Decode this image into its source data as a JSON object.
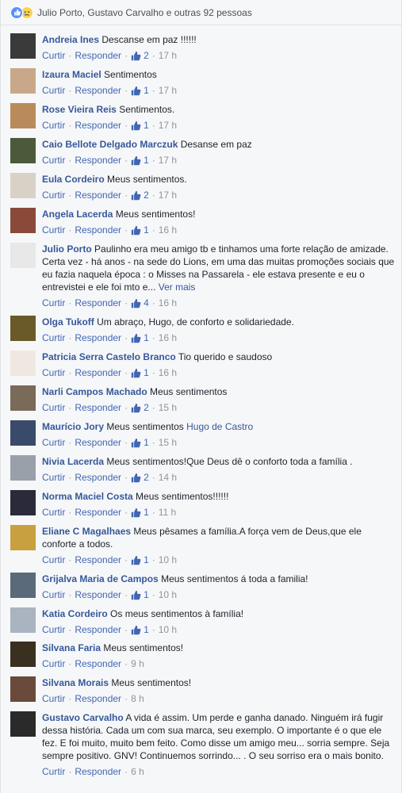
{
  "reactions": {
    "summary": "Julio Porto, Gustavo Carvalho e outras 92 pessoas",
    "like_icon": "like-icon",
    "sad_icon": "sad-icon"
  },
  "actions": {
    "reply": "Responder",
    "like": "Curtir"
  },
  "comments": [
    {
      "name": "Andreia Ines",
      "text": "Descanse em paz !!!!!!",
      "likes": "2",
      "time": "17 h",
      "avatar_color": "#3a3a3a"
    },
    {
      "name": "Izaura Maciel",
      "text": "Sentimentos",
      "likes": "1",
      "time": "17 h",
      "avatar_color": "#c9a88a"
    },
    {
      "name": "Rose Vieira Reis",
      "text": "Sentimentos.",
      "likes": "1",
      "time": "17 h",
      "avatar_color": "#b98a5a"
    },
    {
      "name": "Caio Bellote Delgado Marczuk",
      "text": "Desanse em paz",
      "likes": "1",
      "time": "17 h",
      "avatar_color": "#4a5a3a"
    },
    {
      "name": "Eula Cordeiro",
      "text": "Meus sentimentos.",
      "likes": "2",
      "time": "17 h",
      "avatar_color": "#d8d2c6"
    },
    {
      "name": "Angela Lacerda",
      "text": "Meus sentimentos!",
      "likes": "1",
      "time": "16 h",
      "avatar_color": "#8a4a3a"
    },
    {
      "name": "Julio Porto",
      "text": "Paulinho era meu amigo tb e tinhamos uma forte relação de amizade. Certa vez - há anos - na sede do Lions, em uma das muitas promoções sociais que eu fazia naquela época : o Misses na Passarela - ele estava presente e eu o entrevistei e ele foi mto e...",
      "more": "Ver mais",
      "likes": "4",
      "time": "16 h",
      "avatar_color": "#e8e8e8"
    },
    {
      "name": "Olga Tukoff",
      "text": "Um abraço, Hugo, de conforto e solidariedade.",
      "likes": "1",
      "time": "16 h",
      "avatar_color": "#6a5a2a"
    },
    {
      "name": "Patricia Serra Castelo Branco",
      "text": "Tio querido e saudoso",
      "likes": "1",
      "time": "16 h",
      "avatar_color": "#f0e8e0"
    },
    {
      "name": "Narli Campos Machado",
      "text": "Meus sentimentos",
      "likes": "2",
      "time": "15 h",
      "avatar_color": "#7a6a5a"
    },
    {
      "name": "Maurício Jory",
      "text": "Meus sentimentos",
      "tag": "Hugo de Castro",
      "likes": "1",
      "time": "15 h",
      "avatar_color": "#3a4a6a"
    },
    {
      "name": "Nivia Lacerda",
      "text": "Meus sentimentos!Que Deus dê o conforto toda a família .",
      "likes": "2",
      "time": "14 h",
      "avatar_color": "#9aa0aa"
    },
    {
      "name": "Norma Maciel Costa",
      "text": "Meus sentimentos!!!!!!",
      "likes": "1",
      "time": "11 h",
      "avatar_color": "#2a2a3a"
    },
    {
      "name": "Eliane C Magalhaes",
      "text": "Meus pêsames a família.A força vem de Deus,que ele conforte a todos.",
      "likes": "1",
      "time": "10 h",
      "avatar_color": "#c8a040"
    },
    {
      "name": "Grijalva Maria de Campos",
      "text": "Meus sentimentos á toda a familia!",
      "likes": "1",
      "time": "10 h",
      "avatar_color": "#5a6a7a"
    },
    {
      "name": "Katia Cordeiro",
      "text": "Os meus sentimentos à família!",
      "likes": "1",
      "time": "10 h",
      "avatar_color": "#aab4c0"
    },
    {
      "name": "Silvana Faria",
      "text": "Meus sentimentos!",
      "likes": "",
      "time": "9 h",
      "avatar_color": "#3a3020"
    },
    {
      "name": "Silvana Morais",
      "text": "Meus sentimentos!",
      "likes": "",
      "time": "8 h",
      "avatar_color": "#6a4a3a"
    },
    {
      "name": "Gustavo Carvalho",
      "text": "A vida é assim. Um perde e ganha danado. Ninguém irá fugir dessa história. Cada um com sua marca, seu exemplo. O importante é o que ele fez. E foi muito, muito bem feito. Como disse um amigo meu... sorria sempre. Seja sempre positivo. GNV! Continuemos sorrindo... . O seu sorriso era o mais bonito.",
      "likes": "",
      "time": "6 h",
      "avatar_color": "#2a2a2a"
    }
  ]
}
